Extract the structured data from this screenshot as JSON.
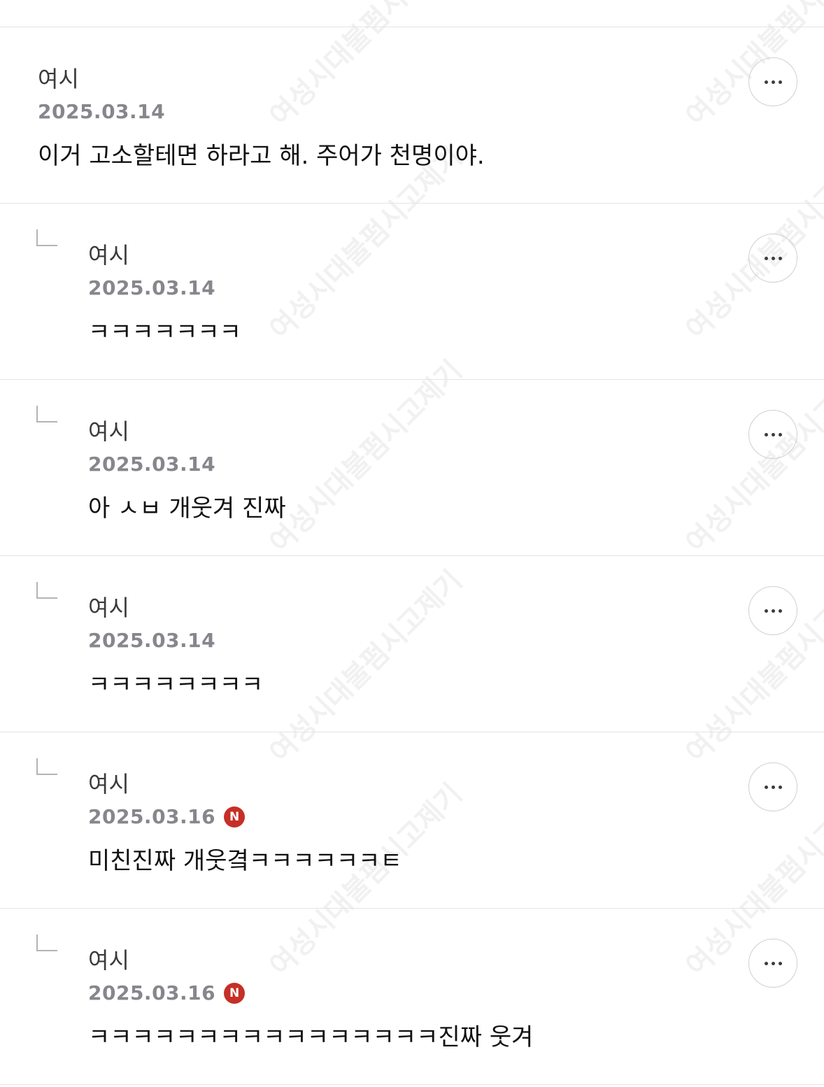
{
  "comments": [
    {
      "author": "여시",
      "date": "2025.03.14",
      "body": "이거 고소할테면 하라고 해. 주어가 천명이야.",
      "is_reply": false,
      "is_new": false
    },
    {
      "author": "여시",
      "date": "2025.03.14",
      "body": "ㅋㅋㅋㅋㅋㅋㅋ",
      "is_reply": true,
      "is_new": false
    },
    {
      "author": "여시",
      "date": "2025.03.14",
      "body": "아 ㅅㅂ 개웃겨 진짜",
      "is_reply": true,
      "is_new": false
    },
    {
      "author": "여시",
      "date": "2025.03.14",
      "body": "ㅋㅋㅋㅋㅋㅋㅋㅋ",
      "is_reply": true,
      "is_new": false
    },
    {
      "author": "여시",
      "date": "2025.03.16",
      "body": "미친진짜 개웃곀ㅋㅋㅋㅋㅋㅋㅌ",
      "is_reply": true,
      "is_new": true
    },
    {
      "author": "여시",
      "date": "2025.03.16",
      "body": "ㅋㅋㅋㅋㅋㅋㅋㅋㅋㅋㅋㅋㅋㅋㅋㅋ진짜 웃겨",
      "is_reply": true,
      "is_new": true
    }
  ],
  "new_badge_label": "N",
  "watermark_text": "여성시대불펌시고제기",
  "colors": {
    "new_badge": "#c62f26",
    "date": "#86868c",
    "divider": "#e4e4e6"
  }
}
